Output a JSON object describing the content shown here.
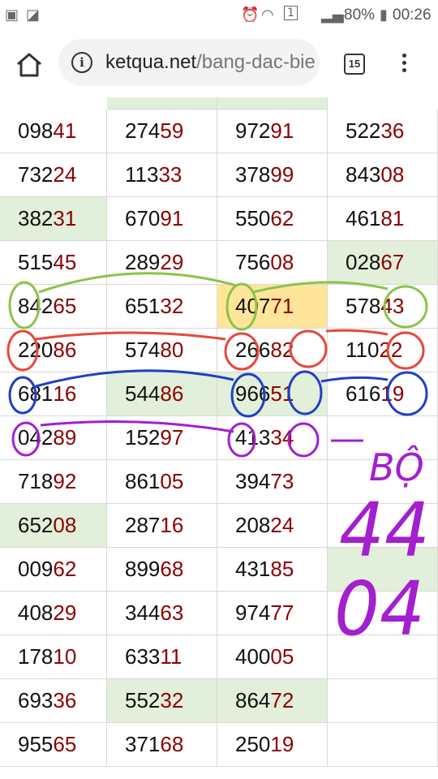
{
  "status_bar": {
    "battery_percent": "80%",
    "time": "00:26",
    "notification_count": "1"
  },
  "browser": {
    "url_domain": "ketqua.net",
    "url_path": "/bang-dac-bie",
    "tab_count": "15"
  },
  "table": {
    "rows": [
      [
        {
          "v": "09841"
        },
        {
          "v": "27459"
        },
        {
          "v": "97291"
        },
        {
          "v": "52236"
        }
      ],
      [
        {
          "v": "73224"
        },
        {
          "v": "11333"
        },
        {
          "v": "37899"
        },
        {
          "v": "84308"
        }
      ],
      [
        {
          "v": "38231",
          "bg": "green"
        },
        {
          "v": "67091"
        },
        {
          "v": "55062"
        },
        {
          "v": "46181"
        }
      ],
      [
        {
          "v": "51545"
        },
        {
          "v": "28929"
        },
        {
          "v": "75608"
        },
        {
          "v": "02867",
          "bg": "green"
        }
      ],
      [
        {
          "v": "84265"
        },
        {
          "v": "65132"
        },
        {
          "v": "40771",
          "bg": "yellow"
        },
        {
          "v": "57843"
        }
      ],
      [
        {
          "v": "22086"
        },
        {
          "v": "57480"
        },
        {
          "v": "26682"
        },
        {
          "v": "11022"
        }
      ],
      [
        {
          "v": "68116"
        },
        {
          "v": "54486",
          "bg": "green"
        },
        {
          "v": "96651",
          "bg": "green"
        },
        {
          "v": "61619"
        }
      ],
      [
        {
          "v": "04289"
        },
        {
          "v": "15297"
        },
        {
          "v": "41334"
        },
        {
          "v": ""
        }
      ],
      [
        {
          "v": "71892"
        },
        {
          "v": "86105"
        },
        {
          "v": "39473"
        },
        {
          "v": ""
        }
      ],
      [
        {
          "v": "65208",
          "bg": "green"
        },
        {
          "v": "28716"
        },
        {
          "v": "20824"
        },
        {
          "v": ""
        }
      ],
      [
        {
          "v": "00962"
        },
        {
          "v": "89968"
        },
        {
          "v": "43185"
        },
        {
          "v": "",
          "bg": "green"
        }
      ],
      [
        {
          "v": "40829"
        },
        {
          "v": "34463"
        },
        {
          "v": "97477"
        },
        {
          "v": ""
        }
      ],
      [
        {
          "v": "17810"
        },
        {
          "v": "63311"
        },
        {
          "v": "40005"
        },
        {
          "v": ""
        }
      ],
      [
        {
          "v": "69336"
        },
        {
          "v": "55232",
          "bg": "green"
        },
        {
          "v": "86472",
          "bg": "green"
        },
        {
          "v": ""
        }
      ],
      [
        {
          "v": "95565"
        },
        {
          "v": "37168"
        },
        {
          "v": "25019"
        },
        {
          "v": ""
        }
      ]
    ]
  },
  "annotation": {
    "word": "BỘ",
    "line1": "44",
    "line2": "04",
    "color_green": "#8bc34a",
    "color_red": "#e8473c",
    "color_blue": "#1f3fc4",
    "color_purple": "#a31fcf"
  }
}
